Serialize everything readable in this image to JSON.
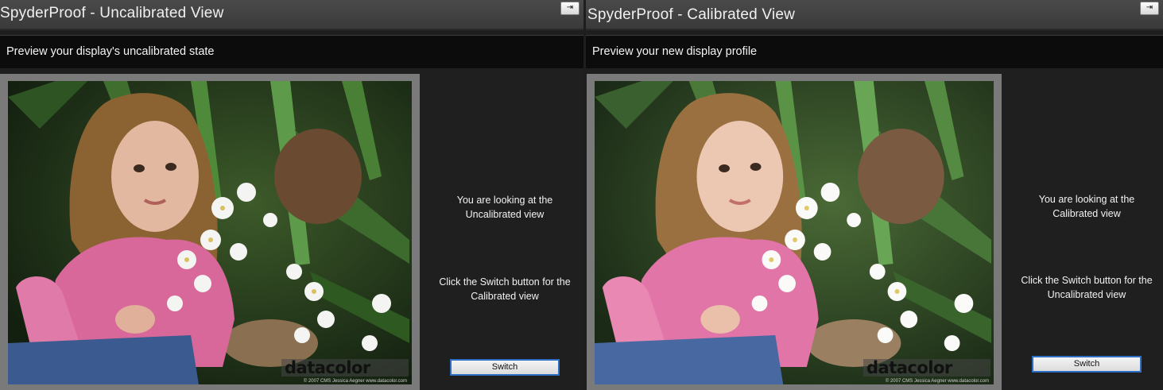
{
  "left_window": {
    "title": "SpyderProof - Uncalibrated View",
    "pin_icon_glyph": "⇥",
    "header": "Preview your display's uncalibrated state",
    "info_line1": "You are looking at the",
    "info_line2": "Uncalibrated view",
    "hint_line1": "Click the Switch button for the",
    "hint_line2": "Calibrated view",
    "switch_label": "Switch",
    "watermark": "datacolor",
    "copyright": "© 2007 CMS Jessica Aegner  www.datacolor.com"
  },
  "right_window": {
    "title": "SpyderProof - Calibrated View",
    "pin_icon_glyph": "⇥",
    "header": "Preview your new display profile",
    "info_line1": "You are looking at the",
    "info_line2": "Calibrated view",
    "hint_line1": "Click the Switch button for the",
    "hint_line2": "Uncalibrated view",
    "switch_label": "Switch",
    "watermark": "datacolor",
    "copyright": "© 2007 CMS Jessica Aegner  www.datacolor.com"
  },
  "colors": {
    "accent_button_border": "#2e6fc6",
    "panel_background": "#1f1f1f",
    "header_band": "#0c0c0c",
    "photo_frame": "#7a7a7a"
  },
  "icons": {
    "pin": "pin-icon"
  }
}
